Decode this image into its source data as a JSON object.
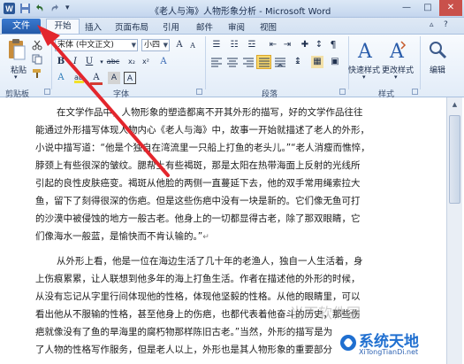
{
  "titlebar": {
    "title": "《老人与海》人物形象分析 - Microsoft Word",
    "minimize": "—",
    "maximize": "□",
    "close": "✕"
  },
  "tabs": {
    "file": "文件",
    "items": [
      "开始",
      "插入",
      "页面布局",
      "引用",
      "邮件",
      "审阅",
      "视图"
    ]
  },
  "ribbon": {
    "clipboard": {
      "paste": "粘贴",
      "group": "剪贴板"
    },
    "font": {
      "font_name": "宋体 (中文正文)",
      "font_size": "小四",
      "bold": "B",
      "italic": "I",
      "underline": "U",
      "strike": "abc",
      "subscript": "x₂",
      "superscript": "x²",
      "group": "字体"
    },
    "paragraph": {
      "group": "段落"
    },
    "styles": {
      "quick": "快速样式",
      "change": "更改样式",
      "group": "样式"
    },
    "editing": {
      "label": "编辑"
    }
  },
  "document": {
    "lines": [
      "在文学作品中，人物形象的塑造都离不开其外形的描写，好的文学作品往往",
      "能通过外形描写体现人物内心《老人与海》中，故事一开始就描述了老人的外形，",
      "小说中描写道：“他是个独自在湾流里一只船上打鱼的老头儿。”“老人消瘦而憔悴，",
      "脖颈上有些很深的皱纹。腮帮上有些褐斑，那是太阳在热带海面上反射的光线所",
      "引起的良性皮肤癌变。褐斑从他脸的两侧一直蔓延下去，他的双手常用绳索拉大",
      "鱼，留下了刻得很深的伤疤。但是这些伤疤中没有一块是新的。它们像无鱼可打",
      "的沙漠中被侵蚀的地方一般古老。他身上的一切都显得古老，除了那双眼睛，它",
      "们像海水一般蓝，是愉快而不肯认输的。”",
      "从外形上看，他是一位在海边生活了几十年的老渔人，独自一人生活着，身",
      "上伤痕累累，让人联想到他多年的海上打鱼生活。作者在描述他的外形的时候，",
      "从没有忘记从字里行间体现他的性格，体现他坚毅的性格。从他的眼睛里，可以",
      "看出他从不服输的性格，甚至他身上的伤疤，也都代表着他奋斗的历史，那些伤",
      "疤就像没有了鱼的旱海里的腐朽物那样陈旧古老。”当然，外形的描写是为",
      "了人物的性格写作服务，但是老人以上，外形也是其人物形象的重要部分"
    ],
    "enter_mark": "↵"
  },
  "watermark": {
    "site_cn": "当下软件园",
    "brand": "系统天地",
    "url": "XiTongTianDi.net"
  },
  "colors": {
    "file_tab": "#2a63b8",
    "arrow": "#e3262d"
  }
}
